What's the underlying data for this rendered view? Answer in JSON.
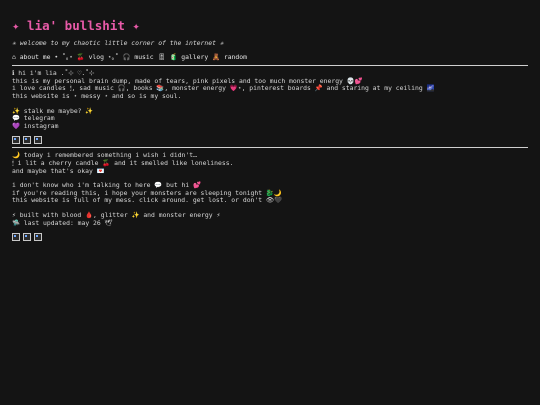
{
  "header": {
    "title": "✦ lia' bullshit ✦",
    "subtitle": "✳ welcome to my chaotic little corner of the internet ✳"
  },
  "nav": {
    "items": [
      {
        "label": "⌂ about me"
      },
      {
        "label": "˚｡⋆ 🍒 vlog ⋆｡˚"
      },
      {
        "label": "🎧 music 🎚"
      },
      {
        "label": "🧃 gallery 🧸"
      },
      {
        "label": "random"
      }
    ]
  },
  "about": {
    "lines": [
      "ℹ hi i'm lia .˚⊹ ♡.˚⊹",
      "this is my personal brain dump, made of tears, pink pixels and too much monster energy 💀💕",
      "i love candles 🕯, sad music 🎧, books 📚, monster energy 💗⋆, pinterest boards 📌 and staring at my ceiling 🌌",
      "this website is ⋆ messy ⋆ and so is my soul."
    ]
  },
  "social": {
    "heading": "✨ stalk me maybe? ✨",
    "links": [
      {
        "label": "💬 telegram"
      },
      {
        "label": "💜 instagram"
      }
    ]
  },
  "post": {
    "lines": [
      "🌙 today i remembered something i wish i didn't…",
      "🕯 i lit a cherry candle 🍒 and it smelled like loneliness.",
      "and maybe that's okay 💌"
    ],
    "lines2": [
      "i don't know who i'm talking to here 💬 but hi 💕",
      "if you're reading this, i hope your monsters are sleeping tonight 🐉🌙",
      "this website is full of my mess. click around. get lost. or don't 👁🖤"
    ]
  },
  "footer": {
    "built": "⚡ built with blood 🩸, glitter ✨ and monster energy ⚡",
    "updated": "🛸 last updated: may 26 🕊"
  }
}
